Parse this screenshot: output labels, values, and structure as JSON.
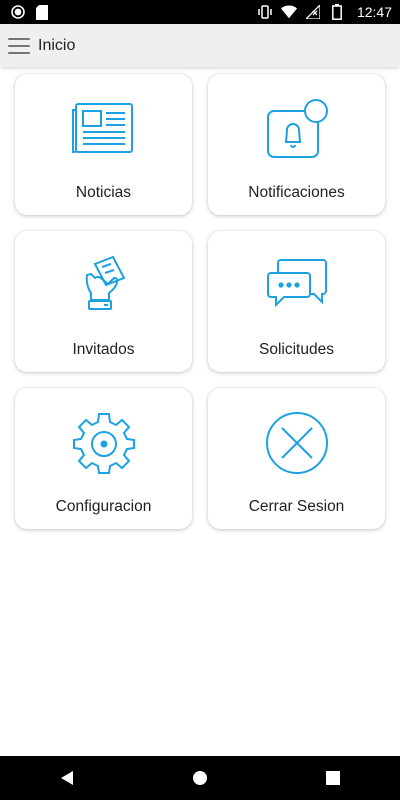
{
  "status_bar": {
    "time": "12:47",
    "icons_left": [
      "record-icon",
      "sd-card-icon"
    ],
    "icons_right": [
      "vibrate-icon",
      "wifi-icon",
      "no-signal-icon",
      "battery-icon"
    ]
  },
  "app_bar": {
    "title": "Inicio",
    "menu_icon": "hamburger-menu-icon"
  },
  "theme": {
    "accent": "#1da1e0",
    "appbar_bg": "#efefef",
    "status_bar_bg": "#000000",
    "nav_bar_bg": "#000000"
  },
  "grid": {
    "items": [
      {
        "label": "Noticias",
        "icon": "newspaper-icon"
      },
      {
        "label": "Notificaciones",
        "icon": "notification-bell-icon"
      },
      {
        "label": "Invitados",
        "icon": "hand-ticket-icon"
      },
      {
        "label": "Solicitudes",
        "icon": "chat-bubbles-icon"
      },
      {
        "label": "Configuracion",
        "icon": "gear-icon"
      },
      {
        "label": "Cerrar Sesion",
        "icon": "close-circle-icon"
      }
    ]
  },
  "nav_bar": {
    "buttons": [
      "back-icon",
      "home-icon",
      "recents-icon"
    ]
  }
}
